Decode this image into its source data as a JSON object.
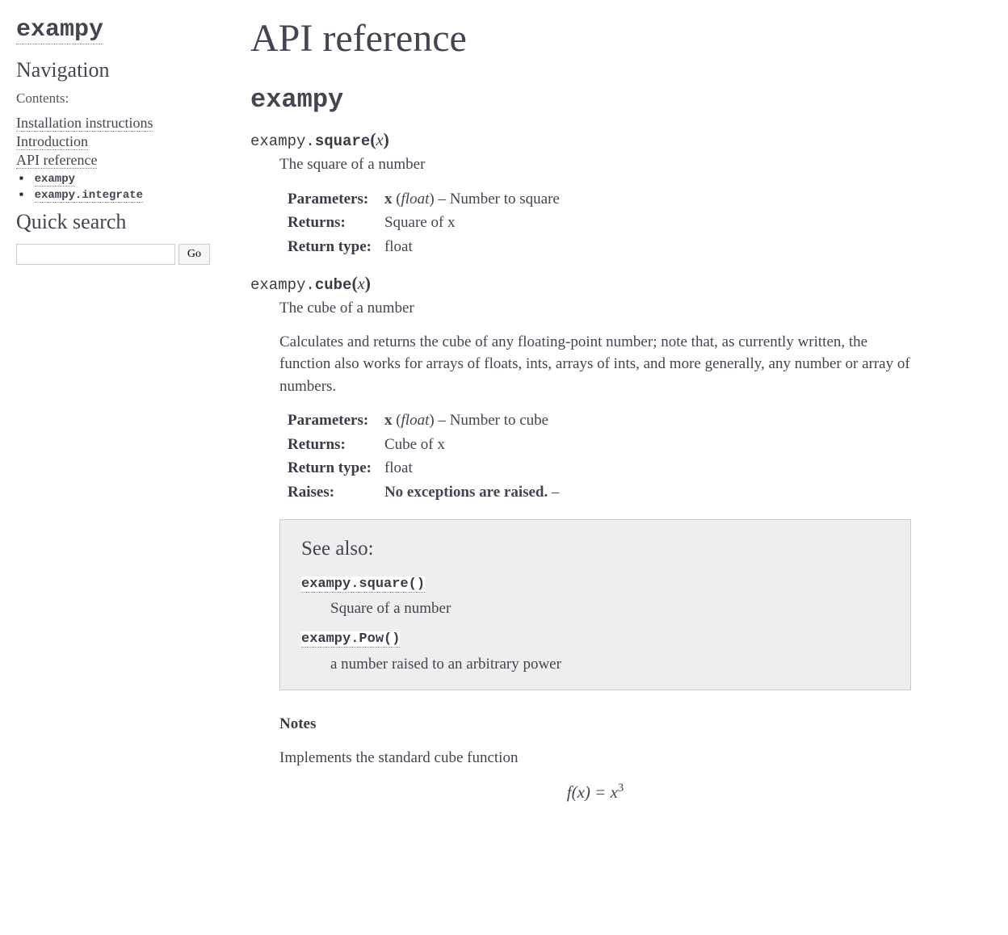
{
  "sidebar": {
    "site_title": "exampy",
    "nav_heading": "Navigation",
    "contents_caption": "Contents:",
    "links": [
      {
        "label": "Installation instructions"
      },
      {
        "label": "Introduction"
      },
      {
        "label": "API reference",
        "children": [
          {
            "label": "exampy"
          },
          {
            "label": "exampy.integrate"
          }
        ]
      }
    ],
    "search_heading": "Quick search",
    "search_button": "Go"
  },
  "main": {
    "page_title": "API reference",
    "module_title": "exampy",
    "square": {
      "modname": "exampy.",
      "funcname": "square",
      "param": "x",
      "summary": "The square of a number",
      "fields": {
        "parameters_label": "Parameters:",
        "param_name": "x",
        "param_type": "float",
        "param_desc": "Number to square",
        "returns_label": "Returns:",
        "returns_desc": "Square of x",
        "rtype_label": "Return type:",
        "rtype_desc": "float"
      }
    },
    "cube": {
      "modname": "exampy.",
      "funcname": "cube",
      "param": "x",
      "summary": "The cube of a number",
      "long": "Calculates and returns the cube of any floating-point number; note that, as currently written, the function also works for arrays of floats, ints, arrays of ints, and more generally, any number or array of numbers.",
      "fields": {
        "parameters_label": "Parameters:",
        "param_name": "x",
        "param_type": "float",
        "param_desc": "Number to cube",
        "returns_label": "Returns:",
        "returns_desc": "Cube of x",
        "rtype_label": "Return type:",
        "rtype_desc": "float",
        "raises_label": "Raises:",
        "raises_desc": "No exceptions are raised."
      },
      "seealso": {
        "title": "See also:",
        "items": [
          {
            "ref": "exampy.square()",
            "desc": "Square of a number"
          },
          {
            "ref": "exampy.Pow()",
            "desc": "a number raised to an arbitrary power"
          }
        ]
      },
      "notes_heading": "Notes",
      "notes_text": "Implements the standard cube function",
      "formula_lhs": "f(x)",
      "formula_eq": " = ",
      "formula_rhs_base": "x",
      "formula_rhs_exp": "3"
    }
  }
}
